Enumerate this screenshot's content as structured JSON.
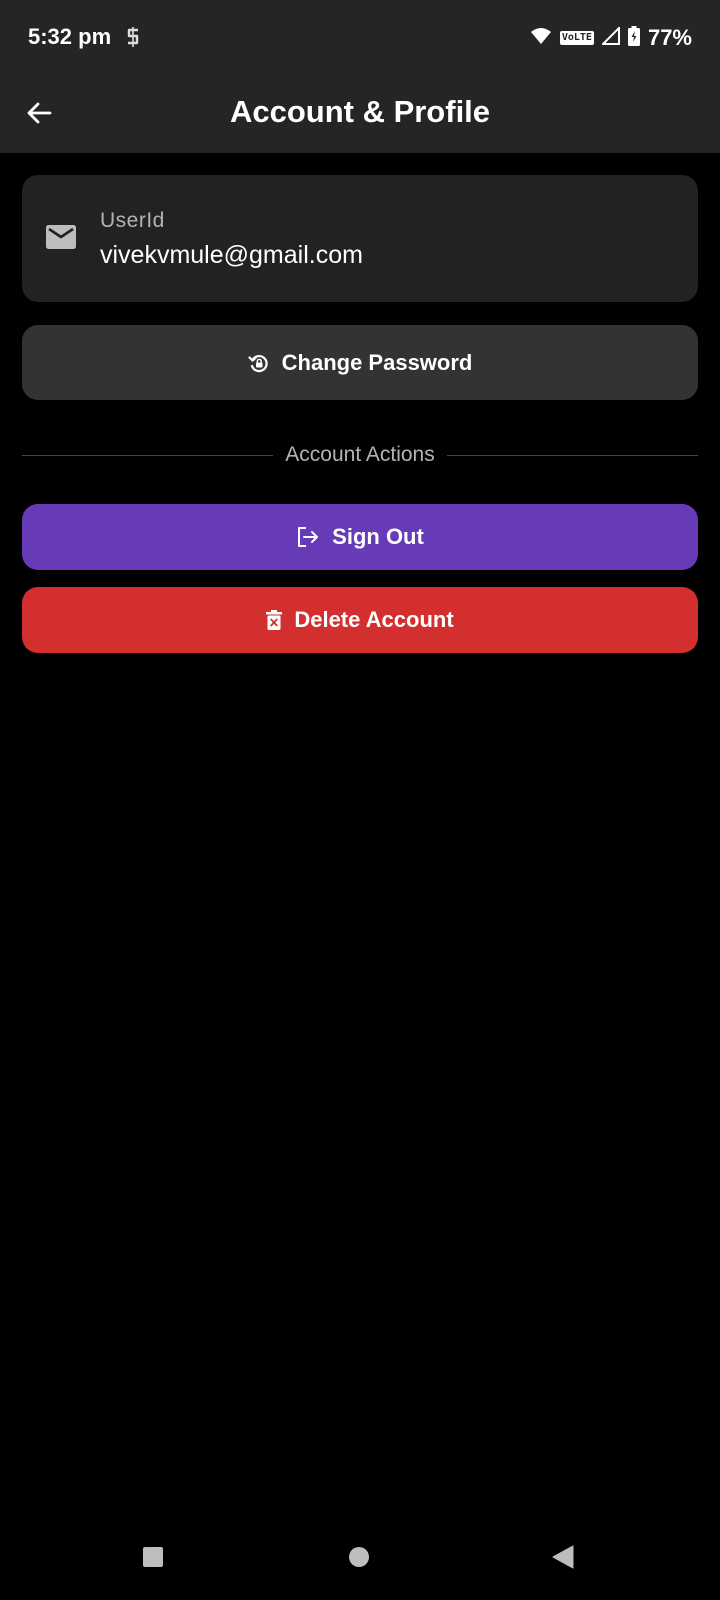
{
  "status_bar": {
    "time": "5:32 pm",
    "battery": "77%",
    "network_badge": "VoLTE"
  },
  "app_bar": {
    "title": "Account & Profile"
  },
  "user_card": {
    "label": "UserId",
    "value": "vivekvmule@gmail.com"
  },
  "actions": {
    "change_password": "Change Password",
    "divider_label": "Account Actions",
    "sign_out": "Sign Out",
    "delete_account": "Delete Account"
  },
  "colors": {
    "bars": "#252525",
    "card": "#222222",
    "secondary_button": "#333333",
    "sign_out": "#673ab7",
    "delete": "#d32f2f"
  }
}
